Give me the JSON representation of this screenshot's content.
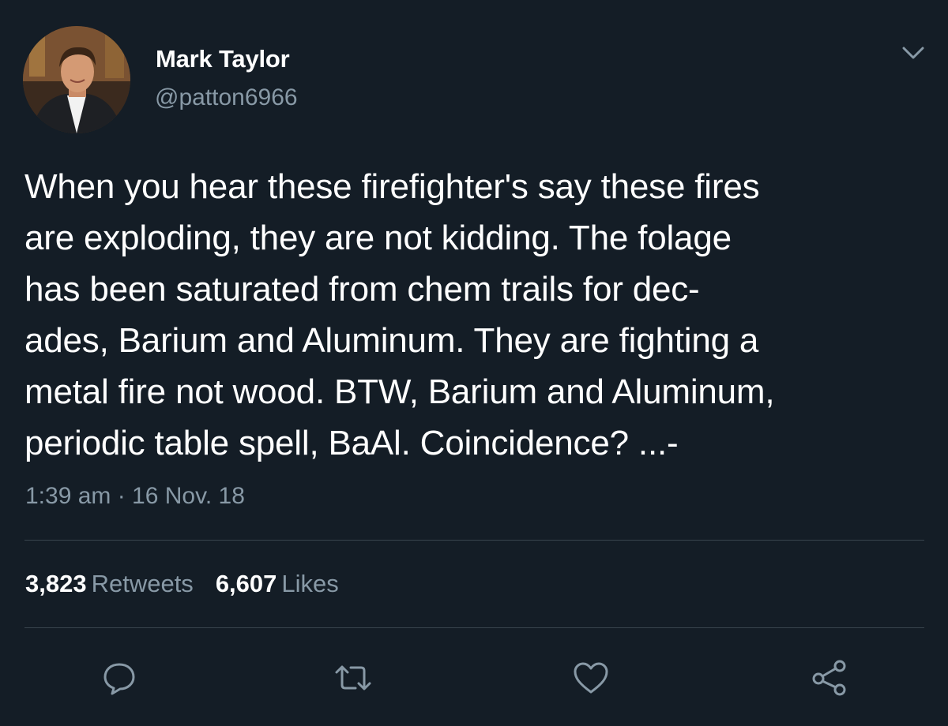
{
  "author": {
    "display_name": "Mark Taylor",
    "handle": "@patton6966"
  },
  "tweet": {
    "text": "When you hear these firefighter's say these fires\nare exploding, they are not kidding. The folage\nhas been saturated from chem trails for dec-\nades, Barium and Aluminum. They are fighting a\nmetal fire not wood. BTW, Barium and Aluminum,\nperiodic table spell, BaAl. Coincidence? ...-",
    "timestamp": "1:39 am · 16 Nov. 18"
  },
  "stats": {
    "retweets_count": "3,823",
    "retweets_label": "Retweets",
    "likes_count": "6,607",
    "likes_label": "Likes"
  },
  "actions": [
    {
      "icon": "reply-icon"
    },
    {
      "icon": "retweet-icon"
    },
    {
      "icon": "like-icon"
    },
    {
      "icon": "share-icon"
    }
  ],
  "colors": {
    "background": "#141d26",
    "primary_text": "#ffffff",
    "secondary_text": "#8899a6",
    "divider": "#38444d"
  }
}
